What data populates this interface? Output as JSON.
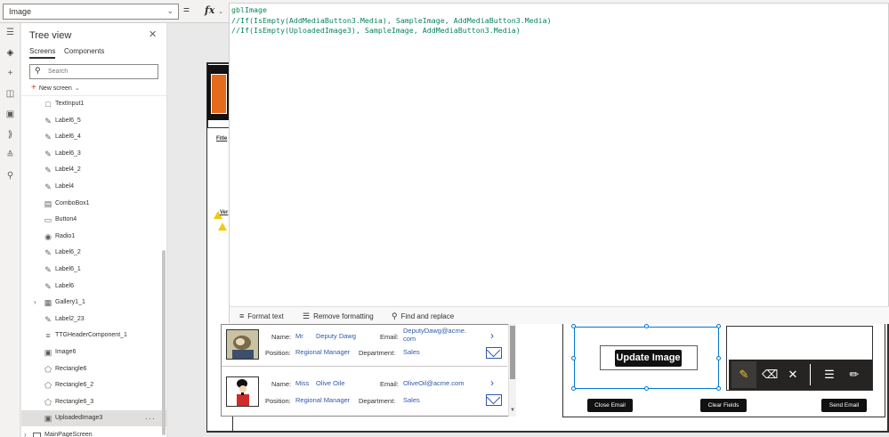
{
  "formula_bar": {
    "property": "Image",
    "equals": "=",
    "fx": "fx"
  },
  "tree": {
    "title": "Tree view",
    "tabs": [
      "Screens",
      "Components"
    ],
    "search_placeholder": "Search",
    "new_screen": "New screen",
    "items": [
      {
        "label": "TextInput1",
        "icon": "text-input-icon"
      },
      {
        "label": "Label6_5",
        "icon": "label-icon"
      },
      {
        "label": "Label6_4",
        "icon": "label-icon"
      },
      {
        "label": "Label6_3",
        "icon": "label-icon"
      },
      {
        "label": "Label4_2",
        "icon": "label-icon"
      },
      {
        "label": "Label4",
        "icon": "label-icon"
      },
      {
        "label": "ComboBox1",
        "icon": "combobox-icon"
      },
      {
        "label": "Button4",
        "icon": "button-icon"
      },
      {
        "label": "Radio1",
        "icon": "radio-icon"
      },
      {
        "label": "Label6_2",
        "icon": "label-icon"
      },
      {
        "label": "Label6_1",
        "icon": "label-icon"
      },
      {
        "label": "Label6",
        "icon": "label-icon"
      },
      {
        "label": "Gallery1_1",
        "icon": "gallery-icon"
      },
      {
        "label": "Label2_23",
        "icon": "label-icon"
      },
      {
        "label": "TTGHeaderComponent_1",
        "icon": "component-icon"
      },
      {
        "label": "Image6",
        "icon": "image-icon"
      },
      {
        "label": "Rectangle6",
        "icon": "shape-icon"
      },
      {
        "label": "Rectangle6_2",
        "icon": "shape-icon"
      },
      {
        "label": "Rectangle6_3",
        "icon": "shape-icon"
      },
      {
        "label": "UploadedImage3",
        "icon": "image-icon",
        "selected": true,
        "more": "···"
      }
    ],
    "screen_item": "MainPageScreen"
  },
  "formula": {
    "lines": [
      "gblImage",
      "//If(IsEmpty(AddMediaButton3.Media), SampleImage, AddMediaButton3.Media)",
      "//If(IsEmpty(UploadedImage3), SampleImage, AddMediaButton3.Media)"
    ],
    "toolbar": {
      "format_text": "Format text",
      "remove_formatting": "Remove formatting",
      "find_replace": "Find and replace"
    }
  },
  "app": {
    "fitle": "Fitle",
    "ver": "Ver",
    "gallery": [
      {
        "name_label": "Name:",
        "title": "Mr",
        "name": "Deputy Dawg",
        "email_label": "Email:",
        "email_line1": "DeputyDawg@acme.",
        "email_line2": "com",
        "position_label": "Position:",
        "position": "Regional Manager",
        "department_label": "Department:",
        "department": "Sales"
      },
      {
        "name_label": "Name:",
        "title": "Miss",
        "name": "Olive Oile",
        "email_label": "Email:",
        "email_line1": "OliveOil@acme.com",
        "email_line2": "",
        "position_label": "Position:",
        "position": "Regional Manager",
        "department_label": "Department:",
        "department": "Sales"
      }
    ],
    "update_image": "Update Image",
    "buttons": {
      "close_email": "Close Email",
      "clear_fields": "Clear Fields",
      "send_email": "Send Email"
    }
  },
  "colors": {
    "accent": "#0078d4",
    "link": "#2f5aa8",
    "code": "#098658",
    "logo": "#e46a1c"
  }
}
